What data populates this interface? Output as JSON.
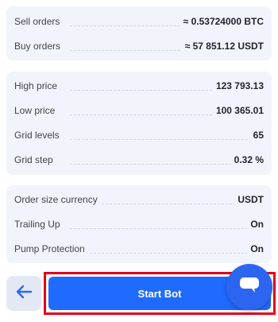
{
  "orders": {
    "sell_label": "Sell orders",
    "sell_value": "≈ 0.53724000 BTC",
    "buy_label": "Buy orders",
    "buy_value": "≈ 57 851.12 USDT"
  },
  "grid": {
    "high_label": "High price",
    "high_value": "123 793.13",
    "low_label": "Low price",
    "low_value": "100 365.01",
    "levels_label": "Grid levels",
    "levels_value": "65",
    "step_label": "Grid step",
    "step_value": "0.32 %"
  },
  "settings": {
    "currency_label": "Order size currency",
    "currency_value": "USDT",
    "trailing_label": "Trailing Up",
    "trailing_value": "On",
    "pump_label": "Pump Protection",
    "pump_value": "On"
  },
  "actions": {
    "back_icon": "arrow-left-icon",
    "start_label": "Start Bot",
    "chat_icon": "chat-bubble-icon"
  },
  "colors": {
    "accent": "#1f6bff",
    "highlight_border": "#e3001b",
    "card_bg": "#f2f4fb"
  }
}
